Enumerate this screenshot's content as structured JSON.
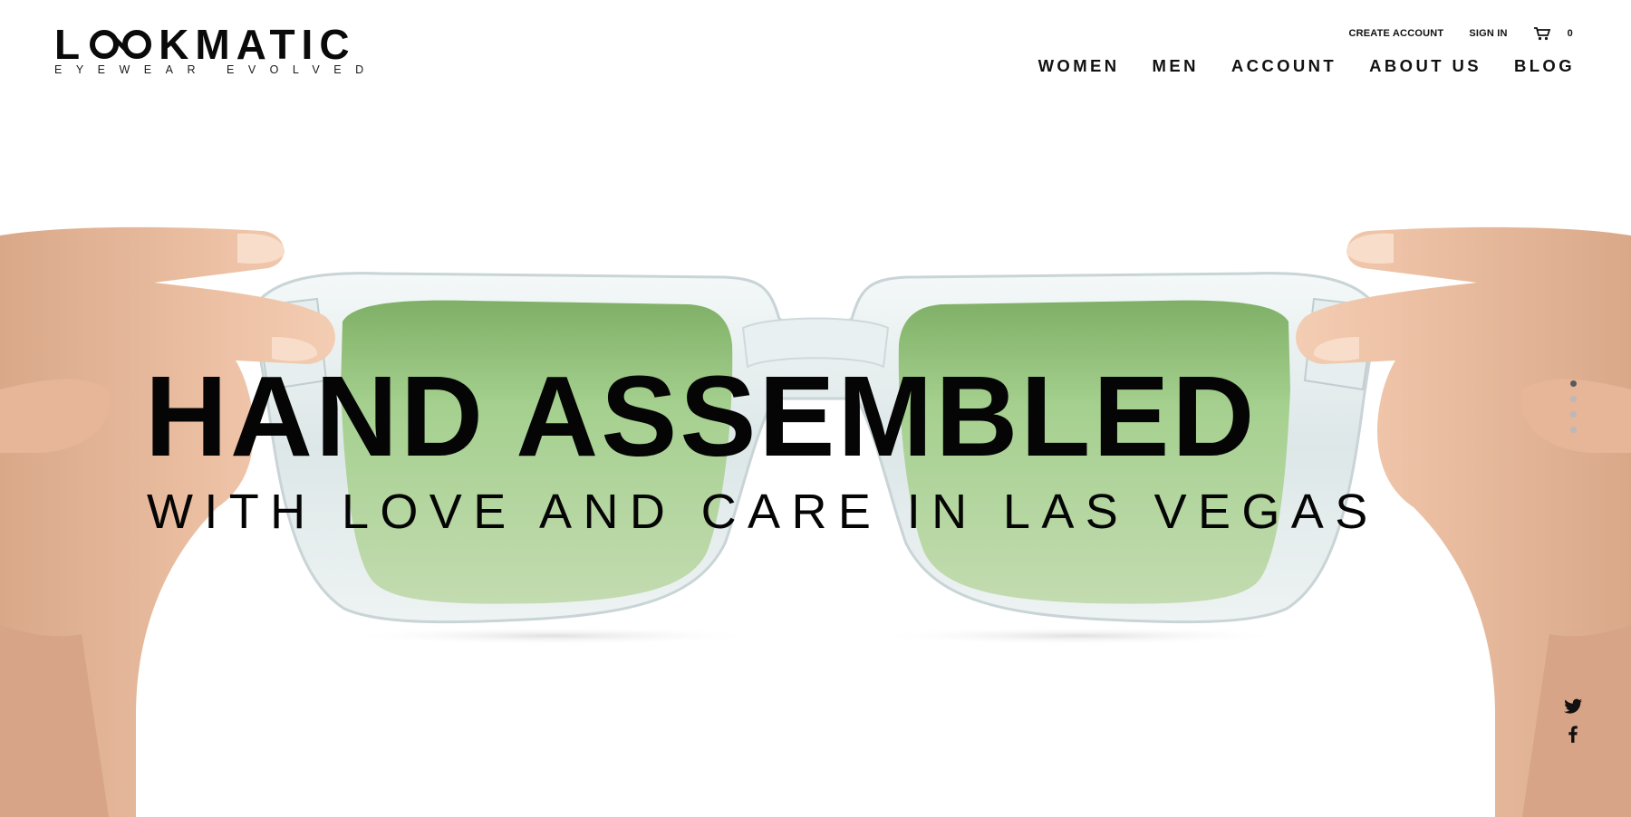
{
  "brand": {
    "name_left": "L",
    "name_right": "KMATIC",
    "tagline": "EYEWEAR EVOLVED"
  },
  "utility_nav": {
    "create_account": "CREATE ACCOUNT",
    "sign_in": "SIGN IN",
    "cart_icon": "shopping-cart-icon",
    "cart_count": "0"
  },
  "main_nav": [
    "WOMEN",
    "MEN",
    "ACCOUNT",
    "ABOUT US",
    "BLOG"
  ],
  "hero": {
    "headline": "HAND ASSEMBLED",
    "subline": "WITH LOVE AND CARE IN LAS VEGAS",
    "lens_color": "#9fca8c"
  },
  "slider": {
    "dot_count": 4,
    "active_index": 0
  },
  "social": {
    "icons": [
      "twitter-icon",
      "facebook-icon"
    ]
  },
  "colors": {
    "text": "#0a0a0a",
    "background": "#ffffff"
  }
}
